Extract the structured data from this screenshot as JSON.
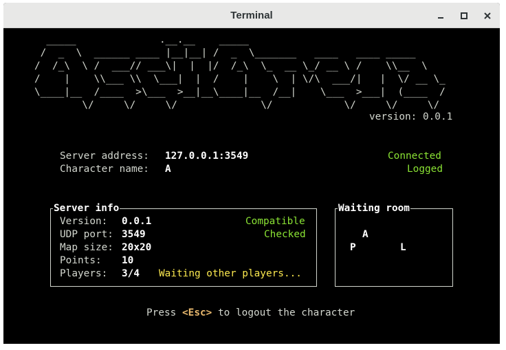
{
  "window": {
    "title": "Terminal"
  },
  "logo": {
    "lines": [
      "  _____              .__.__    _____",
      " /  _  \\  ______ ____ |__|__| /  _  \\_______   ____   ____ _____",
      "/  /_\\  \\ /  ___// ___\\|  |  |/  /_\\  \\_  __ \\_/ __ \\ /    \\\\__  \\",
      "/    |    \\\\___ \\\\  \\___|  |  /    |    \\  | \\/\\  ___/|   |  \\/ __ \\_",
      "\\____|__  /____  >\\___  >__|__\\____|__  /__|    \\___  >___|  (____  /",
      "        \\/     \\/     \\/              \\/            \\/     \\/     \\/"
    ],
    "version": "version: 0.0.1"
  },
  "connection": {
    "address_label": "Server address:",
    "address_value": "127.0.0.1:3549",
    "character_label": "Character name:",
    "character_value": "A",
    "status_connected": "Connected",
    "status_logged": "Logged"
  },
  "server_info": {
    "title": "Server info",
    "version_label": "Version:",
    "version_value": "0.0.1",
    "version_status": "Compatible",
    "udp_label": "UDP port:",
    "udp_value": "3549",
    "udp_status": "Checked",
    "map_label": "Map size:",
    "map_value": "20x20",
    "points_label": "Points:",
    "points_value": "10",
    "players_label": "Players:",
    "players_value": "3/4",
    "players_status": "Waiting other players..."
  },
  "waiting_room": {
    "title": "Waiting room",
    "players": [
      "A",
      "P",
      "L"
    ]
  },
  "footer": {
    "press": "Press",
    "key": "<Esc>",
    "action": "to logout the character"
  },
  "colors": {
    "green": "#8ae234",
    "yellow": "#fce94f",
    "key": "#e9b96e"
  },
  "icons": [
    "minimize-icon",
    "maximize-icon",
    "close-icon"
  ]
}
